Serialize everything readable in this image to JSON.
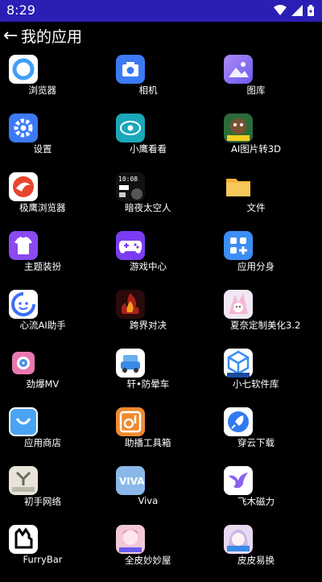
{
  "status": {
    "time": "8:29"
  },
  "header": {
    "title": "我的应用"
  },
  "apps": [
    {
      "label": "浏览器",
      "icon": "browser-icon",
      "color": "#ffffff"
    },
    {
      "label": "相机",
      "icon": "camera-icon",
      "color": "#3c7af5"
    },
    {
      "label": "图库",
      "icon": "gallery-icon",
      "color": "#9b7cf2"
    },
    {
      "label": "设置",
      "icon": "gear-icon",
      "color": "#3c7af5"
    },
    {
      "label": "小鹰看看",
      "icon": "eagle-eye-icon",
      "color": "#1aa7b8"
    },
    {
      "label": "AI图片转3D",
      "icon": "ai-3d-icon",
      "color": "#2d6a3a"
    },
    {
      "label": "极鹰浏览器",
      "icon": "eagle-browser-icon",
      "color": "#ffffff"
    },
    {
      "label": "暗夜太空人",
      "icon": "astronaut-watchface-icon",
      "color": "#111111"
    },
    {
      "label": "文件",
      "icon": "folder-icon",
      "color": "#f5b53a"
    },
    {
      "label": "主题装扮",
      "icon": "theme-tshirt-icon",
      "color": "#8a4af0"
    },
    {
      "label": "游戏中心",
      "icon": "gamepad-icon",
      "color": "#7a3cf0"
    },
    {
      "label": "应用分身",
      "icon": "app-clone-icon",
      "color": "#3c8ef5"
    },
    {
      "label": "心流AI助手",
      "icon": "ai-assistant-icon",
      "color": "#ffffff"
    },
    {
      "label": "跨界对决",
      "icon": "game-fire-icon",
      "color": "#a8221a"
    },
    {
      "label": "夏奈定制美化3.2",
      "icon": "anime-theme-icon",
      "color": "#f0e8f5"
    },
    {
      "label": "劲爆MV",
      "icon": "mv-icon",
      "color": "#e878b0"
    },
    {
      "label": "轩•防晕车",
      "icon": "car-icon",
      "color": "#ffffff"
    },
    {
      "label": "小七软件库",
      "icon": "cube-store-icon",
      "color": "#ffffff"
    },
    {
      "label": "应用商店",
      "icon": "app-store-icon",
      "color": "#4aa3f5"
    },
    {
      "label": "助播工具箱",
      "icon": "toolbox-icon",
      "color": "#f08a30"
    },
    {
      "label": "穿云下载",
      "icon": "rocket-icon",
      "color": "#ffffff"
    },
    {
      "label": "初手网络",
      "icon": "network-logo-icon",
      "color": "#e8e4d8"
    },
    {
      "label": "Viva",
      "icon": "viva-icon",
      "color": "#8ab8e8"
    },
    {
      "label": "飞木磁力",
      "icon": "bird-icon",
      "color": "#ffffff"
    },
    {
      "label": "FurryBar",
      "icon": "furrybar-icon",
      "color": "#ffffff"
    },
    {
      "label": "全皮妙妙屋",
      "icon": "pink-anime-icon",
      "color": "#f2c8d8"
    },
    {
      "label": "皮皮易换",
      "icon": "anime-girl-icon",
      "color": "#e8d8f0"
    }
  ]
}
